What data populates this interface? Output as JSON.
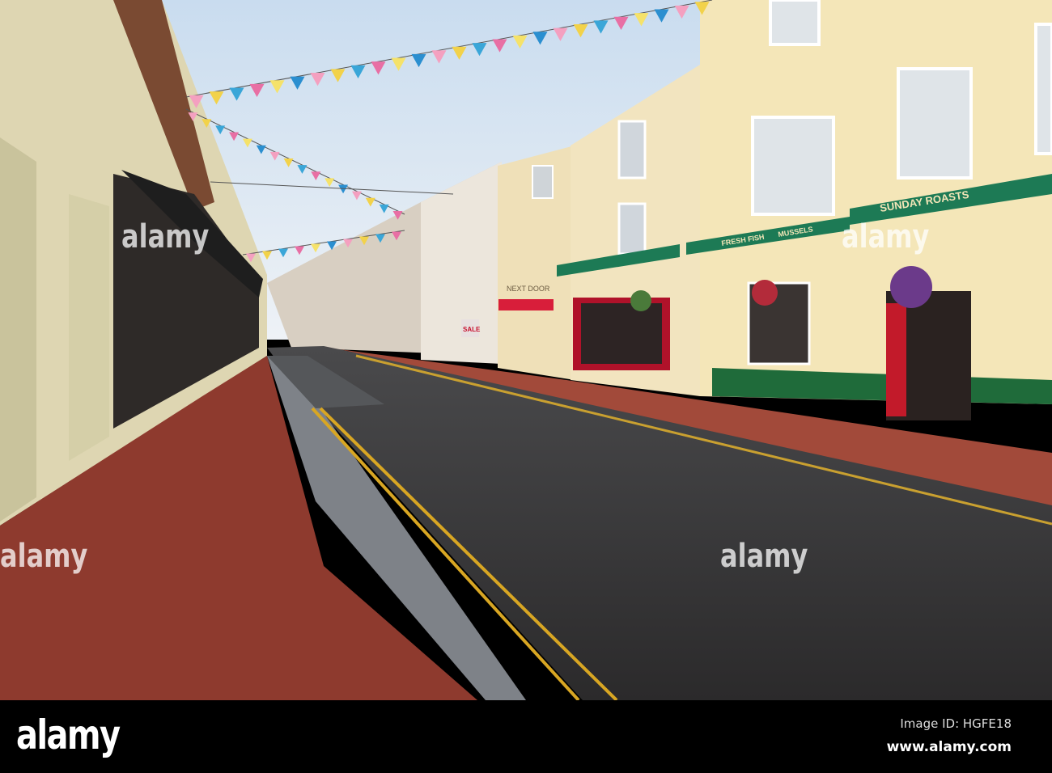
{
  "signs": {
    "sunday_roasts": "SUNDAY ROASTS",
    "fresh_fish": "FRESH FISH",
    "mussels": "MUSSELS",
    "next_door": "NEXT DOOR",
    "sale": "SALE"
  },
  "watermark": {
    "text": "alamy",
    "small_mark": "a"
  },
  "footer": {
    "logo": "alamy",
    "image_id": "Image ID: HGFE18",
    "url": "www.alamy.com"
  },
  "bunting_colors": [
    "#f4a0c0",
    "#f2d24a",
    "#3aa6d8",
    "#e86fa4",
    "#f5e26a",
    "#2b8fd0"
  ]
}
